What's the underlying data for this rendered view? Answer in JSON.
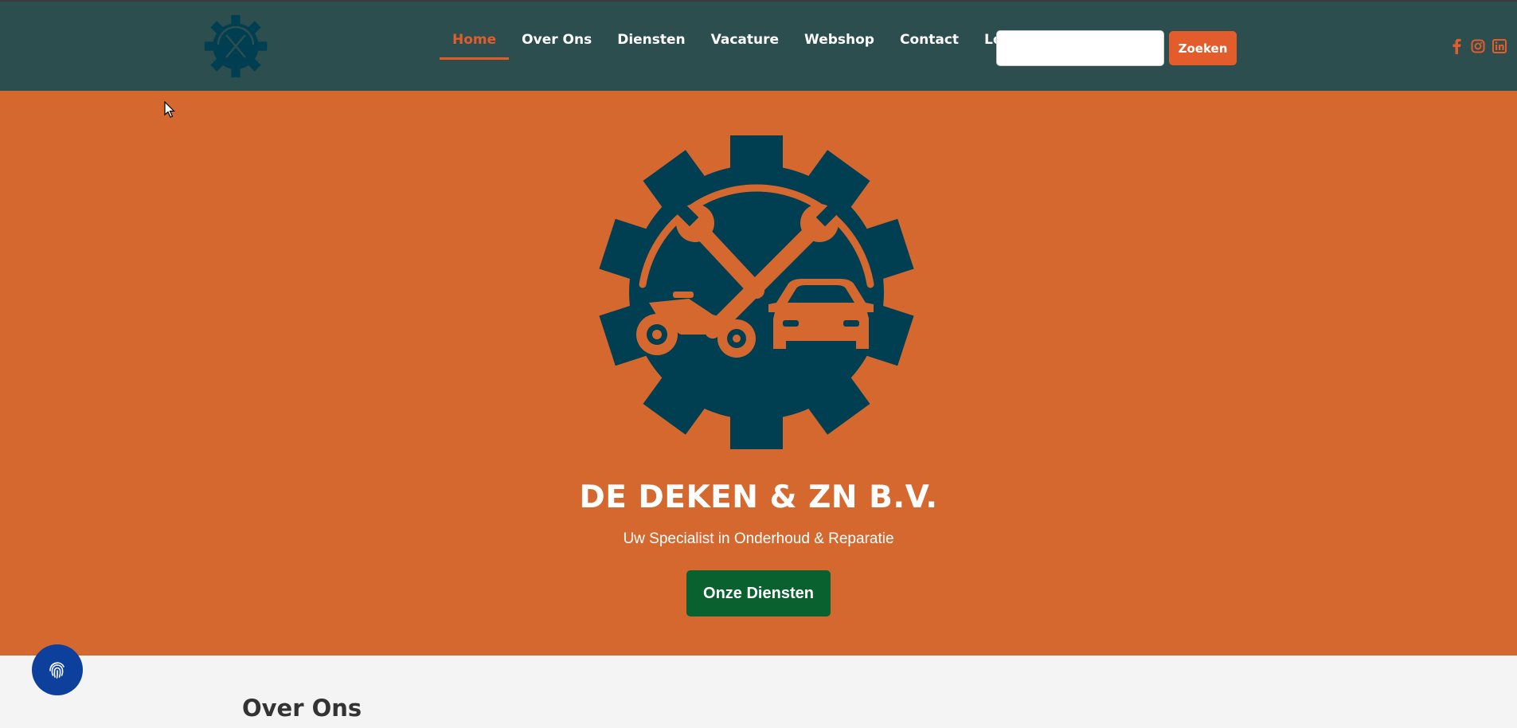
{
  "header": {
    "nav": [
      {
        "label": "Home",
        "active": true
      },
      {
        "label": "Over Ons"
      },
      {
        "label": "Diensten"
      },
      {
        "label": "Vacature"
      },
      {
        "label": "Webshop"
      },
      {
        "label": "Contact"
      },
      {
        "label": "Login"
      }
    ],
    "search": {
      "value": "",
      "button_label": "Zoeken"
    },
    "social_icons": [
      "facebook-icon",
      "instagram-icon",
      "linkedin-icon"
    ]
  },
  "hero": {
    "title": "DE DEKEN & ZN B.V.",
    "subtitle": "Uw Specialist in Onderhoud & Reparatie",
    "cta_label": "Onze Diensten"
  },
  "about": {
    "title": "Over Ons"
  },
  "colors": {
    "header_bg": "#2c4e4f",
    "hero_bg": "#d5682e",
    "accent": "#e35d2c",
    "logo_dark": "#003f52",
    "cta_green": "#08612e",
    "fingerprint_button": "#0d3f9c"
  }
}
